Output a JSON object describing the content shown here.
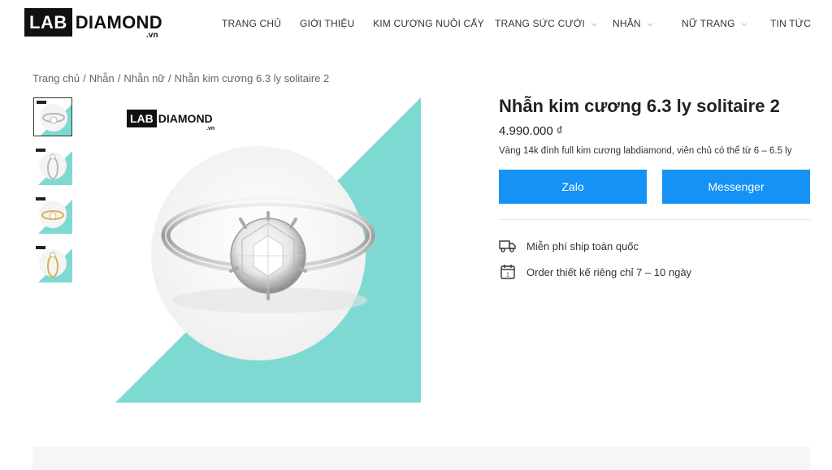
{
  "brand": {
    "logo_text_boxed": "LAB",
    "logo_text": "DIAMOND",
    "logo_suffix": ".vn"
  },
  "nav": {
    "items": [
      {
        "label": "TRANG CHỦ",
        "has_dropdown": false
      },
      {
        "label": "GIỚI THIỆU",
        "has_dropdown": false
      },
      {
        "label": "KIM CƯƠNG NUÔI CẤY",
        "has_dropdown": false
      },
      {
        "label": "TRANG SỨC CƯỚI",
        "has_dropdown": true
      },
      {
        "label": "NHẪN",
        "has_dropdown": true
      },
      {
        "label": "NỮ TRANG",
        "has_dropdown": true
      },
      {
        "label": "TIN TỨC",
        "has_dropdown": false
      }
    ]
  },
  "breadcrumb": {
    "items": [
      "Trang chủ",
      "Nhẫn",
      "Nhẫn nữ",
      "Nhẫn kim cương 6.3 ly solitaire 2"
    ],
    "separator": "/"
  },
  "gallery": {
    "thumbnails": [
      {
        "metal": "white-gold",
        "active": true
      },
      {
        "metal": "white-gold",
        "active": false
      },
      {
        "metal": "yellow-gold",
        "active": false
      },
      {
        "metal": "yellow-gold",
        "active": false
      }
    ],
    "main_logo_boxed": "LAB",
    "main_logo_text": "DIAMOND",
    "main_logo_suffix": ".vn"
  },
  "product": {
    "title": "Nhẫn kim cương 6.3 ly solitaire 2",
    "price": "4.990.000 ₫",
    "description": "Vàng 14k đính full kim cương labdiamond, viên chủ có thể từ 6 – 6.5 ly"
  },
  "buttons": {
    "zalo": "Zalo",
    "messenger": "Messenger"
  },
  "features": [
    {
      "icon": "truck-icon",
      "text": "Miễn phí ship toàn quốc"
    },
    {
      "icon": "calendar-icon",
      "text": "Order thiết kế riêng chỉ 7 – 10 ngày"
    }
  ],
  "colors": {
    "accent": "#1492f5",
    "teal": "#7fd9d3",
    "dark": "#111111"
  }
}
